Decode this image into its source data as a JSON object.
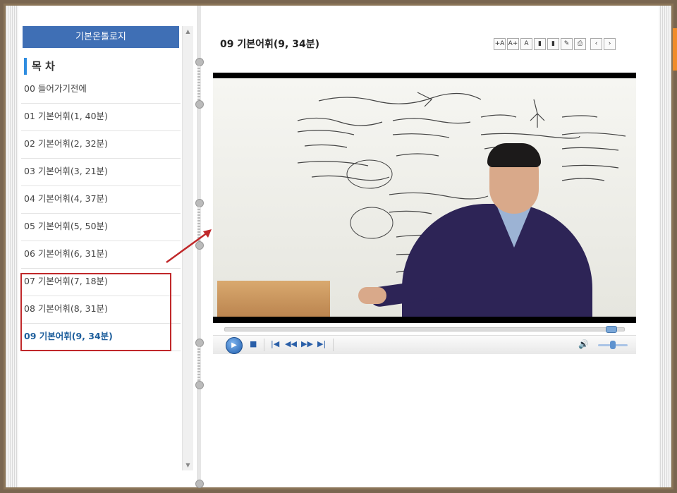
{
  "sidebar": {
    "header": "기본온톨로지",
    "toc_title": "목 차",
    "items": [
      {
        "label": "00 들어가기전에"
      },
      {
        "label": "01 기본어휘(1, 40분)"
      },
      {
        "label": "02 기본어휘(2, 32분)"
      },
      {
        "label": "03 기본어휘(3, 21분)"
      },
      {
        "label": "04 기본어휘(4, 37분)"
      },
      {
        "label": "05 기본어휘(5, 50분)"
      },
      {
        "label": "06 기본어휘(6, 31분)"
      },
      {
        "label": "07 기본어휘(7, 18분)"
      },
      {
        "label": "08 기본어휘(8, 31분)"
      },
      {
        "label": "09 기본어휘(9, 34분)"
      }
    ],
    "active_index": 9
  },
  "content": {
    "title": "09 기본어휘(9, 34분)"
  },
  "toolbar": {
    "buttons": [
      {
        "glyph": "+A",
        "icon": "font-increase-icon"
      },
      {
        "glyph": "A+",
        "icon": "font-larger-icon"
      },
      {
        "glyph": "A",
        "icon": "font-default-icon"
      },
      {
        "glyph": "▮",
        "icon": "bookmark-icon"
      },
      {
        "glyph": "▮",
        "icon": "bookmark-list-icon"
      },
      {
        "glyph": "✎",
        "icon": "memo-icon"
      },
      {
        "glyph": "⎙",
        "icon": "print-icon"
      },
      {
        "glyph": "‹",
        "icon": "prev-page-icon"
      },
      {
        "glyph": "›",
        "icon": "next-page-icon"
      }
    ]
  },
  "player": {
    "progress": 0.97,
    "volume": 0.5,
    "play_glyph": "▶",
    "stop_glyph": "■",
    "prev_glyph": "|◀",
    "rewind_glyph": "◀◀",
    "forward_glyph": "▶▶",
    "next_glyph": "▶|",
    "volume_glyph": "🔊"
  },
  "colors": {
    "header_blue": "#3f6fb5",
    "active_item": "#1d5e9c",
    "annotation_red": "#c0282a"
  }
}
